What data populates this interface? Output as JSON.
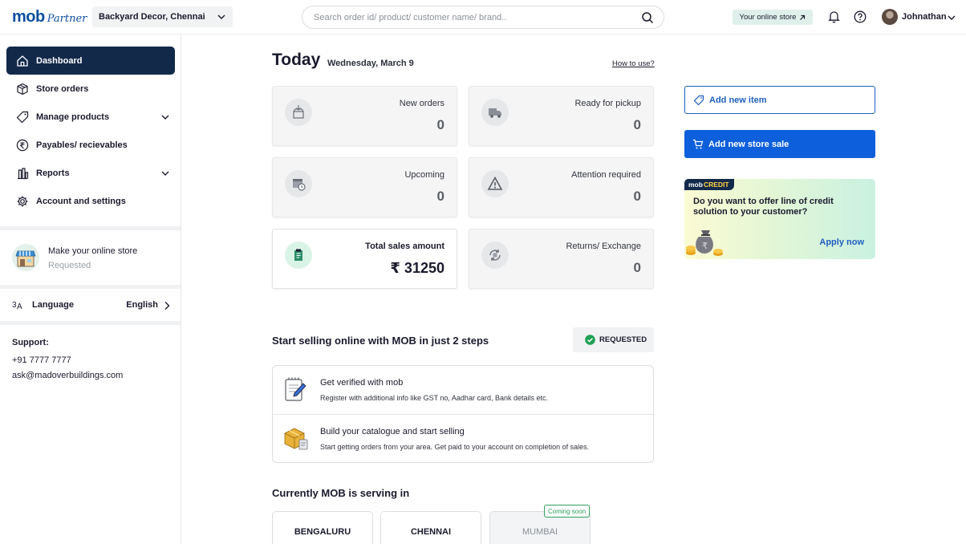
{
  "header": {
    "logo_primary": "mob",
    "logo_secondary": "Partner",
    "store_name": "Backyard Decor, Chennai",
    "search_placeholder": "Search order id/ product/ customer name/ brand..",
    "online_store_label": "Your online store",
    "user_name": "Johnathan"
  },
  "sidebar": {
    "items": [
      {
        "label": "Dashboard",
        "icon": "home-icon",
        "active": true
      },
      {
        "label": "Store orders",
        "icon": "box-icon"
      },
      {
        "label": "Manage products",
        "icon": "tag-icon",
        "expandable": true
      },
      {
        "label": "Payables/ recievables",
        "icon": "rupee-icon"
      },
      {
        "label": "Reports",
        "icon": "chart-icon",
        "expandable": true
      },
      {
        "label": "Account and settings",
        "icon": "gear-icon"
      }
    ],
    "online_store": {
      "title": "Make your online store",
      "status": "Requested"
    },
    "language": {
      "label": "Language",
      "value": "English"
    },
    "support": {
      "title": "Support:",
      "phone": "+91 7777 7777",
      "email": "ask@madoverbuildings.com"
    }
  },
  "today": {
    "title": "Today",
    "date": "Wednesday, March 9",
    "how_to": "How to use?"
  },
  "stats": [
    {
      "label": "New orders",
      "value": "0",
      "icon": "incoming-box-icon"
    },
    {
      "label": "Ready for pickup",
      "value": "0",
      "icon": "truck-icon"
    },
    {
      "label": "Upcoming",
      "value": "0",
      "icon": "calendar-clock-icon"
    },
    {
      "label": "Attention required",
      "value": "0",
      "icon": "warning-icon"
    },
    {
      "label": "Total sales amount",
      "value": "₹ 31250",
      "icon": "receipt-icon"
    },
    {
      "label": "Returns/ Exchange",
      "value": "0",
      "icon": "exchange-icon"
    }
  ],
  "actions": {
    "add_item": "Add new item",
    "add_sale": "Add new store sale"
  },
  "credit": {
    "tag_prefix": "mob",
    "tag_suffix": "CREDIT",
    "question": "Do you want to offer line of credit solution to your customer?",
    "apply": "Apply now"
  },
  "online_selling": {
    "title": "Start selling online with MOB in just 2 steps",
    "status": "REQUESTED",
    "steps": [
      {
        "title": "Get verified with mob",
        "desc": "Register with additional info like GST no, Aadhar card, Bank details etc."
      },
      {
        "title": "Build your catalogue and start selling",
        "desc": "Start getting orders from your area. Get paid to your account on completion of sales."
      }
    ]
  },
  "serving": {
    "title": "Currently MOB is serving in",
    "cities": [
      {
        "name": "BENGALURU"
      },
      {
        "name": "CHENNAI"
      },
      {
        "name": "MUMBAI",
        "badge": "Coming soon"
      }
    ]
  },
  "colors": {
    "brand_blue": "#0c4f9e",
    "sidebar_active": "#12294a",
    "primary_button": "#0d5fdc",
    "success_green": "#2f9e5b"
  }
}
